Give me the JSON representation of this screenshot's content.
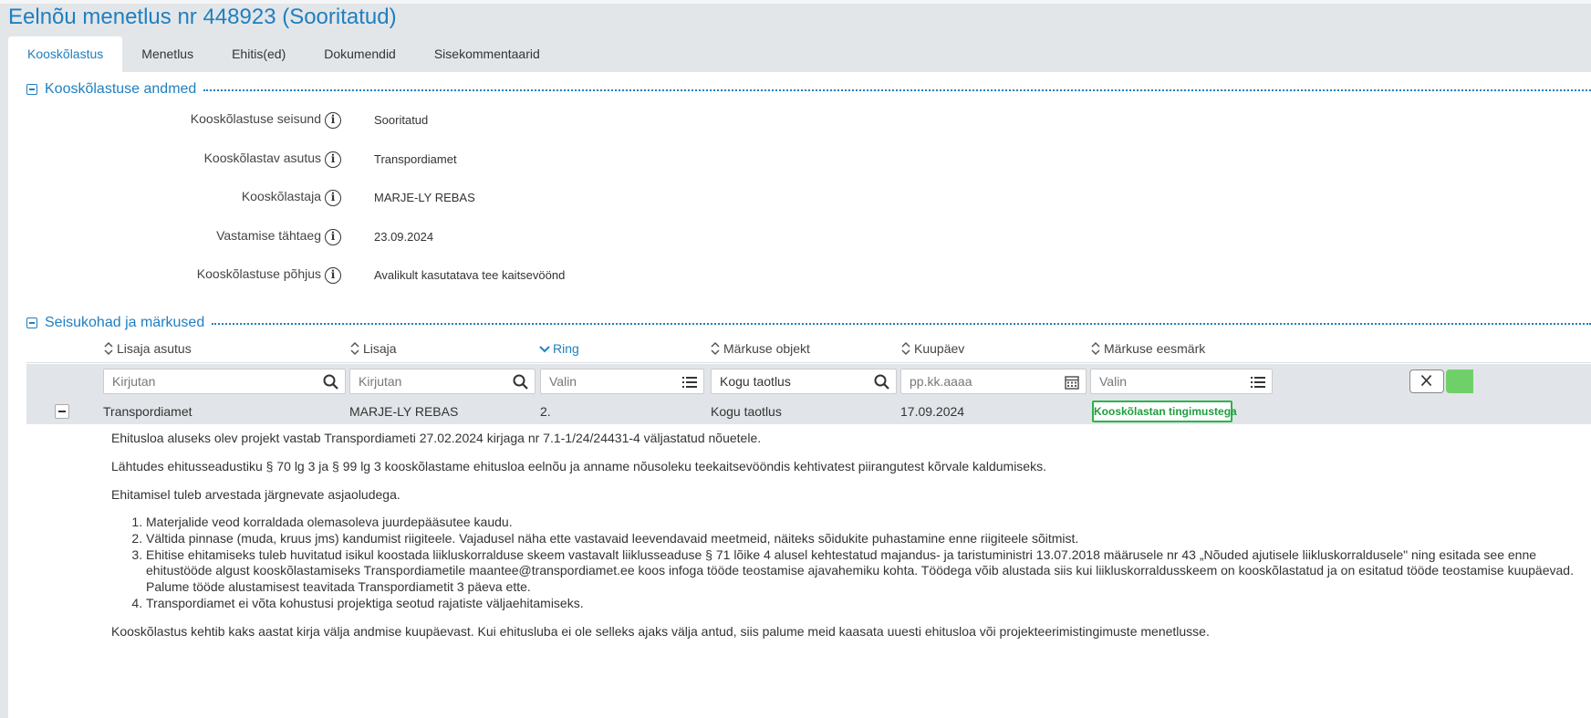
{
  "page": {
    "title": "Eelnõu menetlus nr 448923 (Sooritatud)"
  },
  "tabs": [
    {
      "label": "Kooskõlastus",
      "active": true
    },
    {
      "label": "Menetlus",
      "active": false
    },
    {
      "label": "Ehitis(ed)",
      "active": false
    },
    {
      "label": "Dokumendid",
      "active": false
    },
    {
      "label": "Sisekommentaarid",
      "active": false
    }
  ],
  "section1": {
    "title": "Kooskõlastuse andmed",
    "fields": [
      {
        "label": "Kooskõlastuse seisund",
        "value": "Sooritatud"
      },
      {
        "label": "Kooskõlastav asutus",
        "value": "Transpordiamet"
      },
      {
        "label": "Kooskõlastaja",
        "value": "MARJE-LY REBAS"
      },
      {
        "label": "Vastamise tähtaeg",
        "value": "23.09.2024"
      },
      {
        "label": "Kooskõlastuse põhjus",
        "value": "Avalikult kasutatava tee kaitsevöönd"
      }
    ]
  },
  "section2": {
    "title": "Seisukohad ja märkused",
    "columns": [
      {
        "label": "Lisaja asutus"
      },
      {
        "label": "Lisaja"
      },
      {
        "label": "Ring"
      },
      {
        "label": "Märkuse objekt"
      },
      {
        "label": "Kuupäev"
      },
      {
        "label": "Märkuse eesmärk"
      }
    ],
    "filters": [
      {
        "placeholder": "Kirjutan"
      },
      {
        "placeholder": "Kirjutan"
      },
      {
        "placeholder": "Valin"
      },
      {
        "value": "Kogu taotlus"
      },
      {
        "placeholder": "pp.kk.aaaa"
      },
      {
        "placeholder": "Valin"
      }
    ],
    "row": {
      "asutus": "Transpordiamet",
      "lisaja": "MARJE-LY REBAS",
      "ring": "2.",
      "objekt": "Kogu taotlus",
      "kuupaev": "17.09.2024",
      "eesmark": "Kooskõlastan tingimustega"
    },
    "comment": {
      "p1": "Ehitusloa aluseks olev projekt vastab Transpordiameti 27.02.2024 kirjaga nr 7.1-1/24/24431-4 väljastatud nõuetele.",
      "p2": "Lähtudes ehitusseadustiku § 70 lg 3 ja § 99 lg 3 kooskõlastame ehitusloa eelnõu ja anname nõusoleku teekaitsevööndis kehtivatest piirangutest kõrvale kaldumiseks.",
      "p3": "Ehitamisel tuleb arvestada järgnevate asjaoludega.",
      "list": [
        "Materjalide veod korraldada olemasoleva juurdepääsutee kaudu.",
        "Vältida pinnase (muda, kruus jms) kandumist riigiteele. Vajadusel näha ette vastavaid leevendavaid meetmeid, näiteks sõidukite puhastamine enne riigiteele sõitmist.",
        "Ehitise ehitamiseks tuleb huvitatud isikul koostada liikluskorralduse skeem vastavalt liiklusseaduse § 71 lõike 4 alusel kehtestatud majandus- ja taristuministri 13.07.2018 määrusele nr 43 „Nõuded ajutisele liikluskorraldusele\" ning esitada see enne ehitustööde algust kooskõlastamiseks Transpordiametile maantee@transpordiamet.ee koos infoga tööde teostamise ajavahemiku kohta. Töödega võib alustada siis kui liikluskorraldusskeem on kooskõlastatud ja on esitatud tööde teostamise kuupäevad. Palume tööde alustamisest teavitada Transpordiametit 3 päeva ette.",
        "Transpordiamet ei võta kohustusi projektiga seotud rajatiste väljaehitamiseks."
      ],
      "p4": "Kooskõlastus kehtib kaks aastat kirja välja andmise kuupäevast. Kui ehitusluba ei ole selleks ajaks välja antud, siis palume meid kaasata uuesti ehitusloa või projekteerimistingimuste menetlusse."
    }
  },
  "colors": {
    "accent": "#1f7fc0",
    "badge_green": "#2bb34a",
    "filter_bg": "#e1e5e9"
  }
}
